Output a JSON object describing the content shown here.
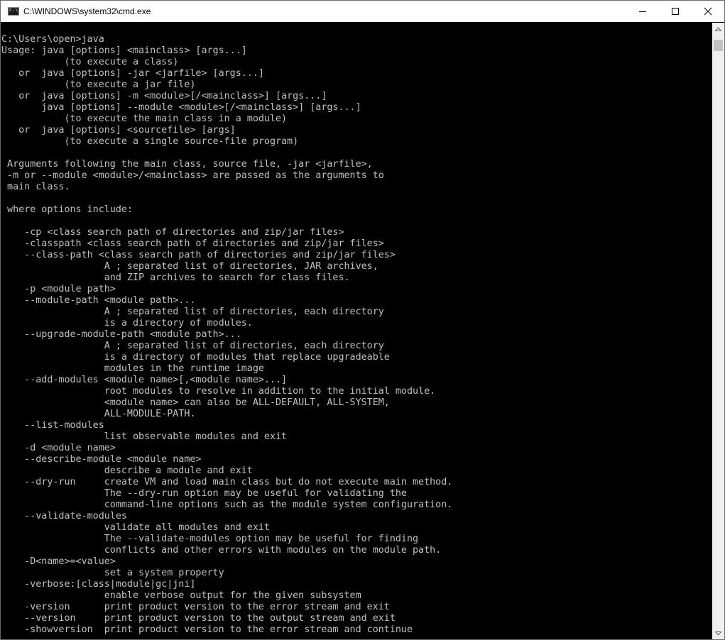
{
  "window": {
    "title": "C:\\WINDOWS\\system32\\cmd.exe",
    "icons": [
      "cmd-app-icon",
      "minimize-icon",
      "maximize-icon",
      "close-icon"
    ]
  },
  "console": {
    "text": "C:\\Users\\open>java\nUsage: java [options] <mainclass> [args...]\n           (to execute a class)\n   or  java [options] -jar <jarfile> [args...]\n           (to execute a jar file)\n   or  java [options] -m <module>[/<mainclass>] [args...]\n       java [options] --module <module>[/<mainclass>] [args...]\n           (to execute the main class in a module)\n   or  java [options] <sourcefile> [args]\n           (to execute a single source-file program)\n\n Arguments following the main class, source file, -jar <jarfile>,\n -m or --module <module>/<mainclass> are passed as the arguments to\n main class.\n\n where options include:\n\n    -cp <class search path of directories and zip/jar files>\n    -classpath <class search path of directories and zip/jar files>\n    --class-path <class search path of directories and zip/jar files>\n                  A ; separated list of directories, JAR archives,\n                  and ZIP archives to search for class files.\n    -p <module path>\n    --module-path <module path>...\n                  A ; separated list of directories, each directory\n                  is a directory of modules.\n    --upgrade-module-path <module path>...\n                  A ; separated list of directories, each directory\n                  is a directory of modules that replace upgradeable\n                  modules in the runtime image\n    --add-modules <module name>[,<module name>...]\n                  root modules to resolve in addition to the initial module.\n                  <module name> can also be ALL-DEFAULT, ALL-SYSTEM,\n                  ALL-MODULE-PATH.\n    --list-modules\n                  list observable modules and exit\n    -d <module name>\n    --describe-module <module name>\n                  describe a module and exit\n    --dry-run     create VM and load main class but do not execute main method.\n                  The --dry-run option may be useful for validating the\n                  command-line options such as the module system configuration.\n    --validate-modules\n                  validate all modules and exit\n                  The --validate-modules option may be useful for finding\n                  conflicts and other errors with modules on the module path.\n    -D<name>=<value>\n                  set a system property\n    -verbose:[class|module|gc|jni]\n                  enable verbose output for the given subsystem\n    -version      print product version to the error stream and exit\n    --version     print product version to the output stream and exit\n    -showversion  print product version to the error stream and continue"
  },
  "colors": {
    "console_background": "#000000",
    "console_text": "#c0c0c0",
    "titlebar_background": "#ffffff",
    "scrollbar_track": "#f0f0f0",
    "scrollbar_thumb": "#c2c2c2"
  }
}
